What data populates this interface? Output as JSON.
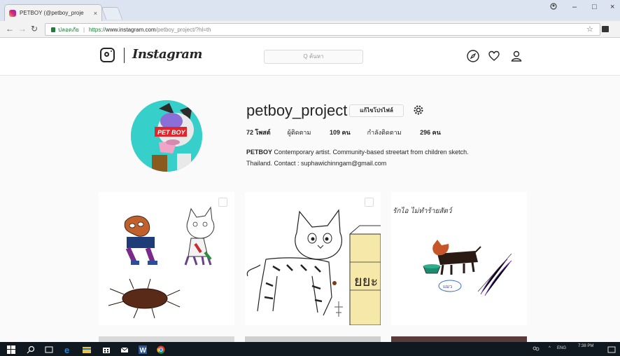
{
  "browser": {
    "tab_title": "PETBOY (@petboy_proje",
    "tab_close": "×",
    "secure_label": "ปลอดภัย",
    "url_scheme": "https://",
    "url_host": "www.instagram.com",
    "url_path": "/petboy_project/?hl=th",
    "window_controls": [
      "–",
      "□",
      "×"
    ]
  },
  "instagram": {
    "wordmark": "Instagram",
    "search_placeholder": "Q ค้นหา"
  },
  "profile": {
    "username": "petboy_project",
    "edit_button": "แก้ไขโปรไฟล์",
    "avatar_badge": "PET BOY",
    "stats": {
      "posts": "72 โพสต์",
      "followers_label": "ผู้ติดตาม",
      "followers_count": "109 คน",
      "following_label": "กำลังติดตาม",
      "following_count": "296 คน"
    },
    "bio_name": "PETBOY",
    "bio_text": " Contemporary artist. Community-based streetart from children sketch.",
    "bio_line2": "Thailand. Contact : suphawichinngam@gmail.com"
  },
  "posts": [
    {
      "icon": "multi-photo-icon"
    },
    {
      "icon": "multi-photo-icon",
      "sign_text": "ยยะ"
    },
    {
      "handwriting": "รักไอ ไม่ทำร้ายสัตว์",
      "bowl_label": "แมว"
    }
  ],
  "taskbar": {
    "lang": "ENG",
    "time": "7:38 PM"
  },
  "colors": {
    "ig_text": "#262626",
    "secure_green": "#188038",
    "taskbar": "#101820",
    "avatar_bg": "#34d3ce"
  }
}
